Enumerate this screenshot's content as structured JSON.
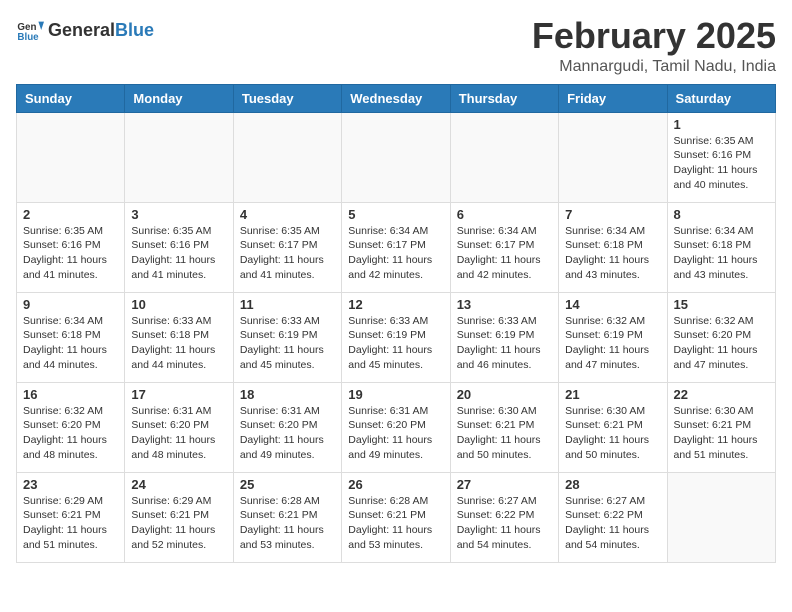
{
  "header": {
    "logo_general": "General",
    "logo_blue": "Blue",
    "month_title": "February 2025",
    "location": "Mannargudi, Tamil Nadu, India"
  },
  "days_of_week": [
    "Sunday",
    "Monday",
    "Tuesday",
    "Wednesday",
    "Thursday",
    "Friday",
    "Saturday"
  ],
  "weeks": [
    [
      {
        "day": "",
        "info": ""
      },
      {
        "day": "",
        "info": ""
      },
      {
        "day": "",
        "info": ""
      },
      {
        "day": "",
        "info": ""
      },
      {
        "day": "",
        "info": ""
      },
      {
        "day": "",
        "info": ""
      },
      {
        "day": "1",
        "info": "Sunrise: 6:35 AM\nSunset: 6:16 PM\nDaylight: 11 hours and 40 minutes."
      }
    ],
    [
      {
        "day": "2",
        "info": "Sunrise: 6:35 AM\nSunset: 6:16 PM\nDaylight: 11 hours and 41 minutes."
      },
      {
        "day": "3",
        "info": "Sunrise: 6:35 AM\nSunset: 6:16 PM\nDaylight: 11 hours and 41 minutes."
      },
      {
        "day": "4",
        "info": "Sunrise: 6:35 AM\nSunset: 6:17 PM\nDaylight: 11 hours and 41 minutes."
      },
      {
        "day": "5",
        "info": "Sunrise: 6:34 AM\nSunset: 6:17 PM\nDaylight: 11 hours and 42 minutes."
      },
      {
        "day": "6",
        "info": "Sunrise: 6:34 AM\nSunset: 6:17 PM\nDaylight: 11 hours and 42 minutes."
      },
      {
        "day": "7",
        "info": "Sunrise: 6:34 AM\nSunset: 6:18 PM\nDaylight: 11 hours and 43 minutes."
      },
      {
        "day": "8",
        "info": "Sunrise: 6:34 AM\nSunset: 6:18 PM\nDaylight: 11 hours and 43 minutes."
      }
    ],
    [
      {
        "day": "9",
        "info": "Sunrise: 6:34 AM\nSunset: 6:18 PM\nDaylight: 11 hours and 44 minutes."
      },
      {
        "day": "10",
        "info": "Sunrise: 6:33 AM\nSunset: 6:18 PM\nDaylight: 11 hours and 44 minutes."
      },
      {
        "day": "11",
        "info": "Sunrise: 6:33 AM\nSunset: 6:19 PM\nDaylight: 11 hours and 45 minutes."
      },
      {
        "day": "12",
        "info": "Sunrise: 6:33 AM\nSunset: 6:19 PM\nDaylight: 11 hours and 45 minutes."
      },
      {
        "day": "13",
        "info": "Sunrise: 6:33 AM\nSunset: 6:19 PM\nDaylight: 11 hours and 46 minutes."
      },
      {
        "day": "14",
        "info": "Sunrise: 6:32 AM\nSunset: 6:19 PM\nDaylight: 11 hours and 47 minutes."
      },
      {
        "day": "15",
        "info": "Sunrise: 6:32 AM\nSunset: 6:20 PM\nDaylight: 11 hours and 47 minutes."
      }
    ],
    [
      {
        "day": "16",
        "info": "Sunrise: 6:32 AM\nSunset: 6:20 PM\nDaylight: 11 hours and 48 minutes."
      },
      {
        "day": "17",
        "info": "Sunrise: 6:31 AM\nSunset: 6:20 PM\nDaylight: 11 hours and 48 minutes."
      },
      {
        "day": "18",
        "info": "Sunrise: 6:31 AM\nSunset: 6:20 PM\nDaylight: 11 hours and 49 minutes."
      },
      {
        "day": "19",
        "info": "Sunrise: 6:31 AM\nSunset: 6:20 PM\nDaylight: 11 hours and 49 minutes."
      },
      {
        "day": "20",
        "info": "Sunrise: 6:30 AM\nSunset: 6:21 PM\nDaylight: 11 hours and 50 minutes."
      },
      {
        "day": "21",
        "info": "Sunrise: 6:30 AM\nSunset: 6:21 PM\nDaylight: 11 hours and 50 minutes."
      },
      {
        "day": "22",
        "info": "Sunrise: 6:30 AM\nSunset: 6:21 PM\nDaylight: 11 hours and 51 minutes."
      }
    ],
    [
      {
        "day": "23",
        "info": "Sunrise: 6:29 AM\nSunset: 6:21 PM\nDaylight: 11 hours and 51 minutes."
      },
      {
        "day": "24",
        "info": "Sunrise: 6:29 AM\nSunset: 6:21 PM\nDaylight: 11 hours and 52 minutes."
      },
      {
        "day": "25",
        "info": "Sunrise: 6:28 AM\nSunset: 6:21 PM\nDaylight: 11 hours and 53 minutes."
      },
      {
        "day": "26",
        "info": "Sunrise: 6:28 AM\nSunset: 6:21 PM\nDaylight: 11 hours and 53 minutes."
      },
      {
        "day": "27",
        "info": "Sunrise: 6:27 AM\nSunset: 6:22 PM\nDaylight: 11 hours and 54 minutes."
      },
      {
        "day": "28",
        "info": "Sunrise: 6:27 AM\nSunset: 6:22 PM\nDaylight: 11 hours and 54 minutes."
      },
      {
        "day": "",
        "info": ""
      }
    ]
  ]
}
